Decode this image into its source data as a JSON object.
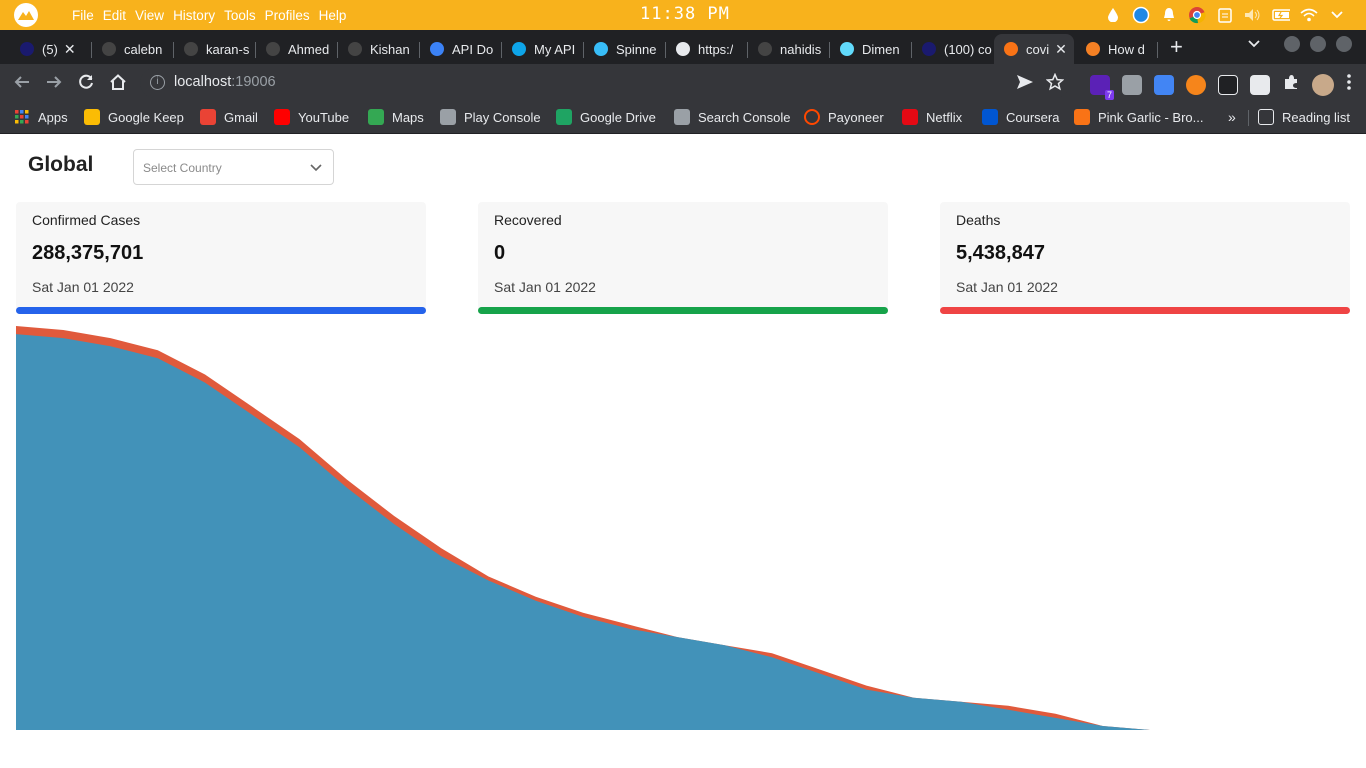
{
  "os": {
    "menu": [
      "File",
      "Edit",
      "View",
      "History",
      "Tools",
      "Profiles",
      "Help"
    ],
    "clock": "11:38 PM"
  },
  "tabs": [
    {
      "label": "(5)",
      "favicon": "#1a1a6e"
    },
    {
      "label": "calebn",
      "favicon": "#444"
    },
    {
      "label": "karan-s",
      "favicon": "#444"
    },
    {
      "label": "Ahmed",
      "favicon": "#444"
    },
    {
      "label": "Kishan",
      "favicon": "#444"
    },
    {
      "label": "API Do",
      "favicon": "#3b82f6"
    },
    {
      "label": "My API",
      "favicon": "#0ea5e9"
    },
    {
      "label": "Spinne",
      "favicon": "#38bdf8"
    },
    {
      "label": "https:/",
      "favicon": "#e8eaed"
    },
    {
      "label": "nahidis",
      "favicon": "#444"
    },
    {
      "label": "Dimen",
      "favicon": "#61dafb"
    },
    {
      "label": "(100) co",
      "favicon": "#1a1a6e"
    },
    {
      "label": "covi",
      "favicon": "#f97316"
    },
    {
      "label": "How d",
      "favicon": "#f48024"
    }
  ],
  "address": {
    "host": "localhost",
    "port": ":19006"
  },
  "bookmarks": [
    {
      "label": "Apps",
      "color": "#4285f4"
    },
    {
      "label": "Google Keep",
      "color": "#fbbc04"
    },
    {
      "label": "Gmail",
      "color": "#ea4335"
    },
    {
      "label": "YouTube",
      "color": "#ff0000"
    },
    {
      "label": "Maps",
      "color": "#34a853"
    },
    {
      "label": "Play Console",
      "color": "#9aa0a6"
    },
    {
      "label": "Google Drive",
      "color": "#1fa463"
    },
    {
      "label": "Search Console",
      "color": "#9aa0a6"
    },
    {
      "label": "Payoneer",
      "color": "#ff4800"
    },
    {
      "label": "Netflix",
      "color": "#e50914"
    },
    {
      "label": "Coursera",
      "color": "#0056d2"
    },
    {
      "label": "Pink Garlic - Bro...",
      "color": "#f97316"
    },
    {
      "label": "Reading list",
      "color": "#e8eaed"
    }
  ],
  "page": {
    "title": "Global",
    "select_placeholder": "Select Country"
  },
  "cards": [
    {
      "label": "Confirmed Cases",
      "value": "288,375,701",
      "date": "Sat Jan 01 2022",
      "color": "#2563eb"
    },
    {
      "label": "Recovered",
      "value": "0",
      "date": "Sat Jan 01 2022",
      "color": "#16a34a"
    },
    {
      "label": "Deaths",
      "value": "5,438,847",
      "date": "Sat Jan 01 2022",
      "color": "#ef4444"
    }
  ],
  "chart_data": {
    "type": "area",
    "series": [
      {
        "values": [
          100,
          99,
          97,
          94,
          88,
          80,
          72,
          62,
          53,
          45,
          38,
          33,
          29,
          26,
          23,
          21,
          19,
          15,
          11,
          8,
          7,
          6,
          4,
          1,
          0
        ]
      },
      {
        "values": [
          98,
          97,
          95,
          92,
          86,
          78,
          70,
          60,
          51,
          43,
          37,
          32,
          28,
          25,
          23,
          21,
          18,
          14,
          10,
          8,
          7,
          5,
          3,
          1,
          0
        ]
      }
    ],
    "colors": [
      "#e05a3c",
      "#4292b9"
    ],
    "ylim": [
      0,
      100
    ]
  }
}
